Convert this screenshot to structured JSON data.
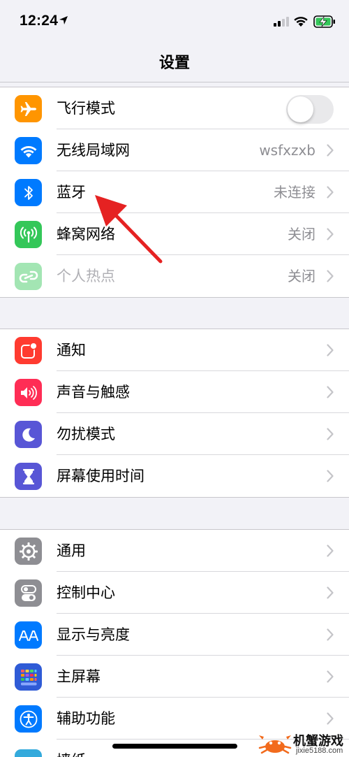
{
  "status": {
    "time": "12:24"
  },
  "nav": {
    "title": "设置"
  },
  "groups": [
    {
      "rows": [
        {
          "label": "飞行模式",
          "icon": "airplane-icon",
          "color": "#ff9500",
          "toggle": false
        },
        {
          "label": "无线局域网",
          "icon": "wifi-icon",
          "color": "#007aff",
          "value": "wsfxzxb"
        },
        {
          "label": "蓝牙",
          "icon": "bluetooth-icon",
          "color": "#007aff",
          "value": "未连接"
        },
        {
          "label": "蜂窝网络",
          "icon": "cellular-icon",
          "color": "#34c759",
          "value": "关闭"
        },
        {
          "label": "个人热点",
          "icon": "hotspot-icon",
          "color": "#34c759",
          "value": "关闭",
          "disabled": true
        }
      ]
    },
    {
      "rows": [
        {
          "label": "通知",
          "icon": "notifications-icon",
          "color": "#ff3b30"
        },
        {
          "label": "声音与触感",
          "icon": "sound-icon",
          "color": "#ff2d55"
        },
        {
          "label": "勿扰模式",
          "icon": "moon-icon",
          "color": "#5856d6"
        },
        {
          "label": "屏幕使用时间",
          "icon": "hourglass-icon",
          "color": "#5856d6"
        }
      ]
    },
    {
      "rows": [
        {
          "label": "通用",
          "icon": "gear-icon",
          "color": "#8e8e93"
        },
        {
          "label": "控制中心",
          "icon": "toggles-icon",
          "color": "#8e8e93"
        },
        {
          "label": "显示与亮度",
          "icon": "text-size-icon",
          "color": "#007aff"
        },
        {
          "label": "主屏幕",
          "icon": "home-grid-icon",
          "color": "#2f5bd6"
        },
        {
          "label": "辅助功能",
          "icon": "accessibility-icon",
          "color": "#007aff"
        },
        {
          "label": "墙纸",
          "icon": "wallpaper-icon",
          "color": "#34aadc"
        }
      ]
    }
  ],
  "watermark": {
    "title": "机蟹游戏",
    "url": "jixie5188.com"
  }
}
